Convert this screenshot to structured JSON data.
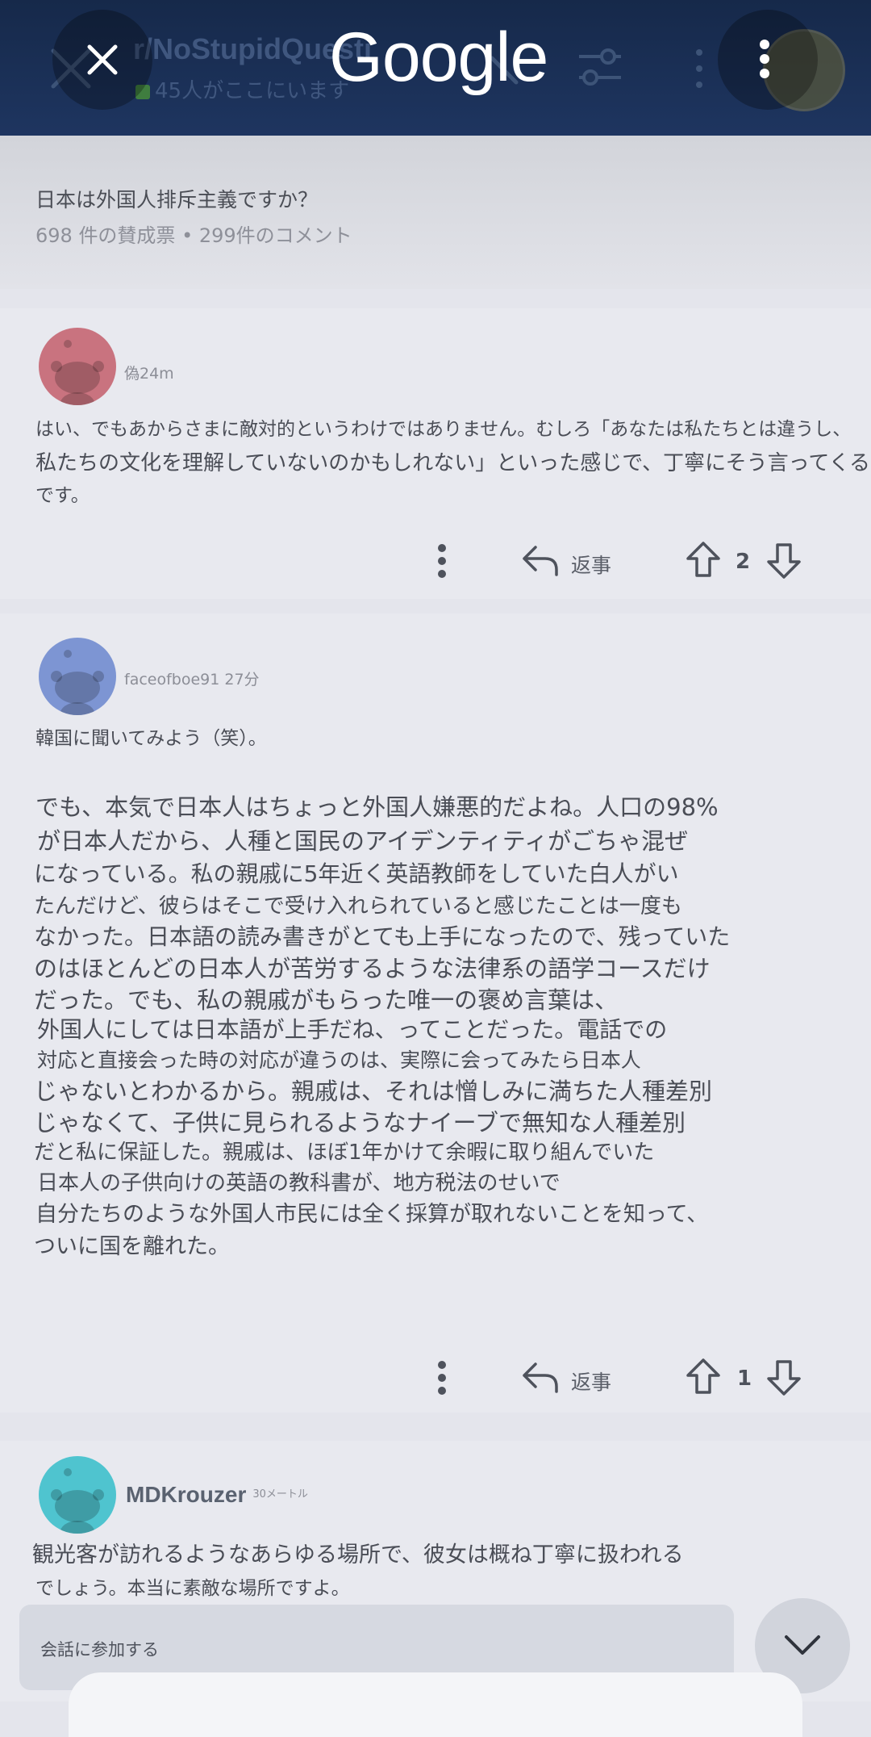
{
  "header": {
    "brand": "Google",
    "subreddit": "r/NoStupidQuesti",
    "online_count": "45人がここにいます"
  },
  "post": {
    "title": "日本は外国人排斥主義ですか？",
    "meta": "698 件の賛成票 • 299件のコメント"
  },
  "comments": [
    {
      "user": "偽24m",
      "avatar_color": "#c9737f",
      "lines": [
        "はい、でもあからさまに敵対的というわけではありません。むしろ「あなたは私たちとは違うし、",
        "私たちの文化を理解していないのかもしれない」といった感じで、丁寧にそう言ってくる感じ",
        "です。"
      ],
      "reply_label": "返事",
      "score": "2"
    },
    {
      "user": "faceofboe91 27分",
      "avatar_color": "#7d95d3",
      "intro": "韓国に聞いてみよう（笑）。",
      "lines": [
        "でも、本気で日本人はちょっと外国人嫌悪的だよね。人口の98%",
        "が日本人だから、人種と国民のアイデンティティがごちゃ混ぜ",
        "になっている。私の親戚に5年近く英語教師をしていた白人がい",
        "たんだけど、彼らはそこで受け入れられていると感じたことは一度も",
        "なかった。日本語の読み書きがとても上手になったので、残っていた",
        "のはほとんどの日本人が苦労するような法律系の語学コースだけ",
        "だった。でも、私の親戚がもらった唯一の褒め言葉は、",
        "外国人にしては日本語が上手だね、ってことだった。電話での",
        "対応と直接会った時の対応が違うのは、実際に会ってみたら日本人",
        "じゃないとわかるから。親戚は、それは憎しみに満ちた人種差別",
        "じゃなくて、子供に見られるようなナイーブで無知な人種差別",
        "だと私に保証した。親戚は、ほぼ1年かけて余暇に取り組んでいた",
        "日本人の子供向けの英語の教科書が、地方税法のせいで",
        "自分たちのような外国人市民には全く採算が取れないことを知って、",
        "ついに国を離れた。"
      ],
      "reply_label": "返事",
      "score": "1"
    },
    {
      "user": "MDKrouzer",
      "age": "30メートル",
      "avatar_color": "#4fc4cf",
      "lines": [
        "観光客が訪れるようなあらゆる場所で、彼女は概ね丁寧に扱われる",
        "でしょう。本当に素敵な場所ですよ。"
      ]
    }
  ],
  "footer": {
    "join_label": "会話に参加する"
  }
}
